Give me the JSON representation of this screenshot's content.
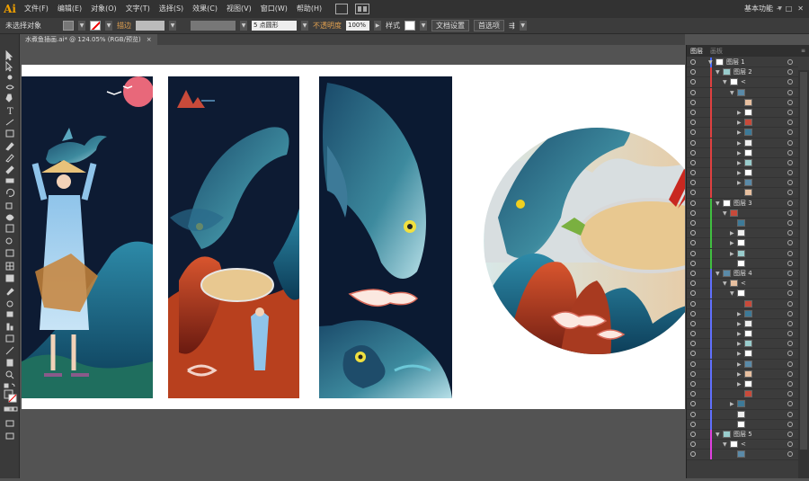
{
  "app": {
    "logo": "Ai"
  },
  "menu": [
    "文件(F)",
    "编辑(E)",
    "对象(O)",
    "文字(T)",
    "选择(S)",
    "效果(C)",
    "视图(V)",
    "窗口(W)",
    "帮助(H)"
  ],
  "workspace": "基本功能",
  "control": {
    "selection": "未选择对象",
    "stroke_label": "描边",
    "brush_value": "5 点圆形",
    "opacity_label": "不透明度",
    "opacity_value": "100%",
    "style_label": "样式",
    "doc_setup": "文档设置",
    "prefs": "首选项"
  },
  "document": {
    "tab_title": "水煮鱼插画.ai* @ 124.05% (RGB/预览)",
    "close": "×"
  },
  "panel": {
    "tab_layers": "图层",
    "tab_artboards": "画板",
    "menu_icon": "≡"
  },
  "layers": [
    {
      "name": "图层 1",
      "level": 0,
      "color": "#4a6cff",
      "arrow": "▼"
    },
    {
      "name": "图层 2",
      "level": 1,
      "color": "#e04040",
      "arrow": "▼"
    },
    {
      "name": "<",
      "level": 2,
      "color": "#e04040",
      "arrow": "▼"
    },
    {
      "name": "",
      "level": 3,
      "color": "#e04040",
      "arrow": "▼"
    },
    {
      "name": "",
      "level": 4,
      "color": "#e04040",
      "arrow": ""
    },
    {
      "name": "",
      "level": 4,
      "color": "#e04040",
      "arrow": "▶"
    },
    {
      "name": "",
      "level": 4,
      "color": "#e04040",
      "arrow": "▶"
    },
    {
      "name": "",
      "level": 4,
      "color": "#e04040",
      "arrow": "▶"
    },
    {
      "name": "",
      "level": 4,
      "color": "#e04040",
      "arrow": "▶"
    },
    {
      "name": "",
      "level": 4,
      "color": "#e04040",
      "arrow": "▶"
    },
    {
      "name": "",
      "level": 4,
      "color": "#e04040",
      "arrow": "▶"
    },
    {
      "name": "",
      "level": 4,
      "color": "#e04040",
      "arrow": "▶"
    },
    {
      "name": "",
      "level": 4,
      "color": "#e04040",
      "arrow": "▶"
    },
    {
      "name": "",
      "level": 4,
      "color": "#e04040",
      "arrow": ""
    },
    {
      "name": "图层 3",
      "level": 1,
      "color": "#40c040",
      "arrow": "▼"
    },
    {
      "name": "",
      "level": 2,
      "color": "#40c040",
      "arrow": "▼"
    },
    {
      "name": "",
      "level": 3,
      "color": "#40c040",
      "arrow": ""
    },
    {
      "name": "",
      "level": 3,
      "color": "#40c040",
      "arrow": "▶"
    },
    {
      "name": "",
      "level": 3,
      "color": "#40c040",
      "arrow": "▶"
    },
    {
      "name": "",
      "level": 3,
      "color": "#40c040",
      "arrow": "▶"
    },
    {
      "name": "",
      "level": 3,
      "color": "#40c040",
      "arrow": ""
    },
    {
      "name": "图层 4",
      "level": 1,
      "color": "#6070ff",
      "arrow": "▼"
    },
    {
      "name": "<",
      "level": 2,
      "color": "#6070ff",
      "arrow": "▼"
    },
    {
      "name": "",
      "level": 3,
      "color": "#6070ff",
      "arrow": "▼"
    },
    {
      "name": "",
      "level": 4,
      "color": "#6070ff",
      "arrow": ""
    },
    {
      "name": "",
      "level": 4,
      "color": "#6070ff",
      "arrow": "▶"
    },
    {
      "name": "",
      "level": 4,
      "color": "#6070ff",
      "arrow": "▶"
    },
    {
      "name": "",
      "level": 4,
      "color": "#6070ff",
      "arrow": "▶"
    },
    {
      "name": "",
      "level": 4,
      "color": "#6070ff",
      "arrow": "▶"
    },
    {
      "name": "",
      "level": 4,
      "color": "#6070ff",
      "arrow": "▶"
    },
    {
      "name": "",
      "level": 4,
      "color": "#6070ff",
      "arrow": "▶"
    },
    {
      "name": "",
      "level": 4,
      "color": "#6070ff",
      "arrow": "▶"
    },
    {
      "name": "",
      "level": 4,
      "color": "#6070ff",
      "arrow": "▶"
    },
    {
      "name": "",
      "level": 4,
      "color": "#6070ff",
      "arrow": ""
    },
    {
      "name": "",
      "level": 3,
      "color": "#6070ff",
      "arrow": "▶"
    },
    {
      "name": "",
      "level": 3,
      "color": "#6070ff",
      "arrow": ""
    },
    {
      "name": "",
      "level": 3,
      "color": "#6070ff",
      "arrow": ""
    },
    {
      "name": "图层 5",
      "level": 1,
      "color": "#e040e0",
      "arrow": "▼"
    },
    {
      "name": "<",
      "level": 2,
      "color": "#e040e0",
      "arrow": "▼"
    },
    {
      "name": "",
      "level": 3,
      "color": "#e040e0",
      "arrow": ""
    }
  ]
}
